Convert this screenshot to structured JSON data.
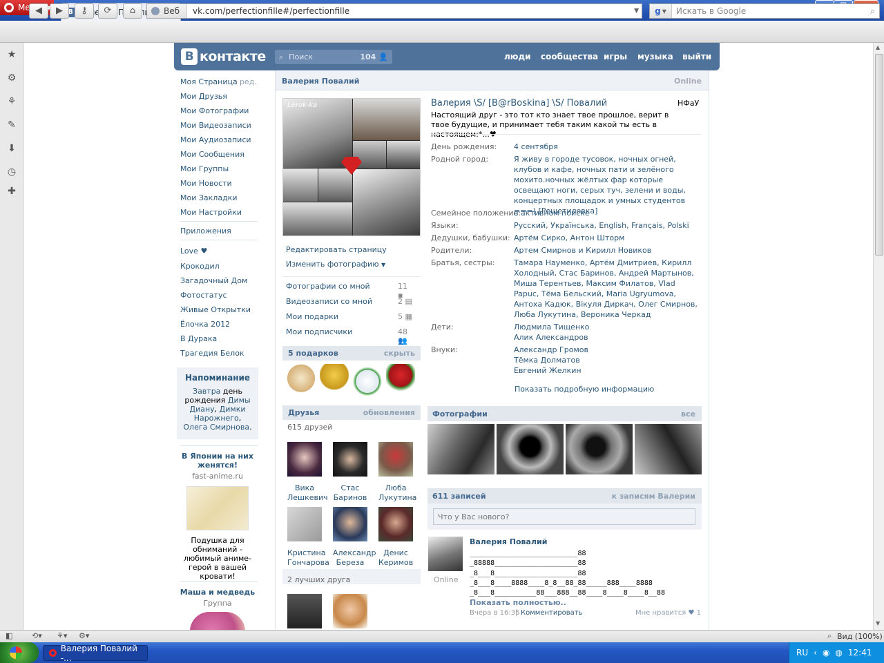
{
  "browser": {
    "menu_label": "Меню",
    "tab_title": "Валерия Повалий",
    "new_tab": "+",
    "address_prefix": "Веб",
    "url": "vk.com/perfectionfille#/perfectionfille",
    "search_placeholder": "Искать в Google",
    "status_zoom": "Вид (100%)"
  },
  "taskbar": {
    "start": "пуск",
    "task_label": "Валерия Повалий -...",
    "lang": "RU",
    "clock": "12:41"
  },
  "vk": {
    "logo": "контакте",
    "logo_badge": "В",
    "search_placeholder": "Поиск",
    "search_count": "104",
    "nav": [
      "люди",
      "сообщества",
      "игры",
      "музыка",
      "выйти"
    ],
    "left_menu": [
      "Моя Страница",
      "Мои Друзья",
      "Мои Фотографии",
      "Мои Видеозаписи",
      "Мои Аудиозаписи",
      "Мои Сообщения",
      "Мои Группы",
      "Мои Новости",
      "Мои Закладки",
      "Мои Настройки"
    ],
    "edit_label": "ред.",
    "apps_label": "Приложения",
    "app_items": [
      "Love ♥",
      "Крокодил",
      "Загадочный Дом",
      "Фотостатус",
      "Живые Открытки",
      "Ёлочка 2012",
      "В Дурака",
      "Трагедия Белок"
    ],
    "reminder": {
      "title": "Напоминание",
      "text_parts": [
        "Завтра",
        " день рождения ",
        "Димы Диану",
        ", ",
        "Димки Нарожнего",
        ", ",
        "Олега Смирнова",
        "."
      ]
    },
    "ad1": {
      "title": "В Японии на них женятся!",
      "site": "fast-anime.ru",
      "text": "Подушка для обниманий - любимый аниме-герой в вашей кровати!"
    },
    "ad2": {
      "title": "Маша и медведь",
      "sub": "Группа"
    }
  },
  "profile": {
    "header_name": "Валерия Повалий",
    "header_status": "Online",
    "edit_page": "Редактировать страницу",
    "change_photo": "Изменить фотографию",
    "avatar_caption": "Lerok-ka",
    "mini_links": [
      {
        "label": "Фотографии со мной",
        "count": "11"
      },
      {
        "label": "Видеозаписи со мной",
        "count": "2"
      },
      {
        "label": "Мои подарки",
        "count": "5"
      },
      {
        "label": "Мои подписчики",
        "count": "48"
      }
    ],
    "gifts": {
      "title": "5 подарков",
      "action": "скрыть"
    },
    "friends": {
      "title": "Друзья",
      "action": "обновления",
      "count": "615 друзей",
      "best": "2 лучших друга",
      "list": [
        {
          "first": "Вика",
          "last": "Лешкевич"
        },
        {
          "first": "Стас",
          "last": "Баринов"
        },
        {
          "first": "Люба",
          "last": "Лукутина"
        },
        {
          "first": "Кристина",
          "last": "Гончарова"
        },
        {
          "first": "Александр",
          "last": "Береза"
        },
        {
          "first": "Денис",
          "last": "Керимов"
        }
      ]
    },
    "name_line": "Валерия \\S/ [B@rBoskina] \\S/ Повалий",
    "nfau": "НФаУ",
    "status_text": "Настоящий друг - это тот кто знает твое прошлое, верит в твое будущие, и принимает тебя таким какой ты есть в настоящем:*...♥",
    "info": [
      {
        "label": "День рождения:",
        "value": "4 сентября"
      },
      {
        "label": "Родной город:",
        "value": "Я живу в городе тусовок, ночных огней, клубов и кафе, ночных пати и зелёного мохито.ночных жёлтых фар которые освещают ноги, серых туч, зелени и воды, концертных площадок и умных студентов ===) [Решетиловка]"
      },
      {
        "label": "Семейное положение:",
        "value": "в активном поиске"
      },
      {
        "label": "Языки:",
        "value": "Русский, Українська, English, Français, Polski"
      },
      {
        "label": "Дедушки, бабушки:",
        "value": "Артём Сирко, Антон Шторм"
      },
      {
        "label": "Родители:",
        "value": "Артем Смирнов и Кирилл Новиков"
      },
      {
        "label": "Братья, сестры:",
        "value": "Тамара Науменко, Артём Дмитриев, Кирилл Холодный, Стас Баринов, Андрей Мартынов, Миша Терентьев, Максим Филатов, Vlad Papuc, Тёма Бельский, Maria Ugryumova, Антоха Кадюк, Вікуля Диркач, Олег Смирнов, Люба Лукутина, Вероника Черкад"
      },
      {
        "label": "Дети:",
        "value": "Людмила Тищенко\nАлик Александров"
      },
      {
        "label": "Внуки:",
        "value": "Александр Громов\nТёмка Долматов\nЕвгений Желкин"
      }
    ],
    "show_more": "Показать подробную информацию",
    "photos": {
      "title": "Фотографии",
      "action": "все"
    },
    "wall": {
      "title": "611 записей",
      "action": "к записям Валерии",
      "placeholder": "Что у Вас нового?"
    },
    "post": {
      "author": "Валерия Повалий",
      "status": "Online",
      "lines": [
        "__________________________88",
        "_88888____________________88",
        "_8___8____________________88",
        "_8___8____8888____8_8__88_88_____888____8888",
        "_8___8__________88___888__88____8____8____8__88"
      ],
      "expand": "Показать полностью..",
      "time": "Вчера в 16:36",
      "separator": "|",
      "comment": "Комментировать",
      "like_label": "Мне нравится",
      "like_count": "1"
    }
  }
}
